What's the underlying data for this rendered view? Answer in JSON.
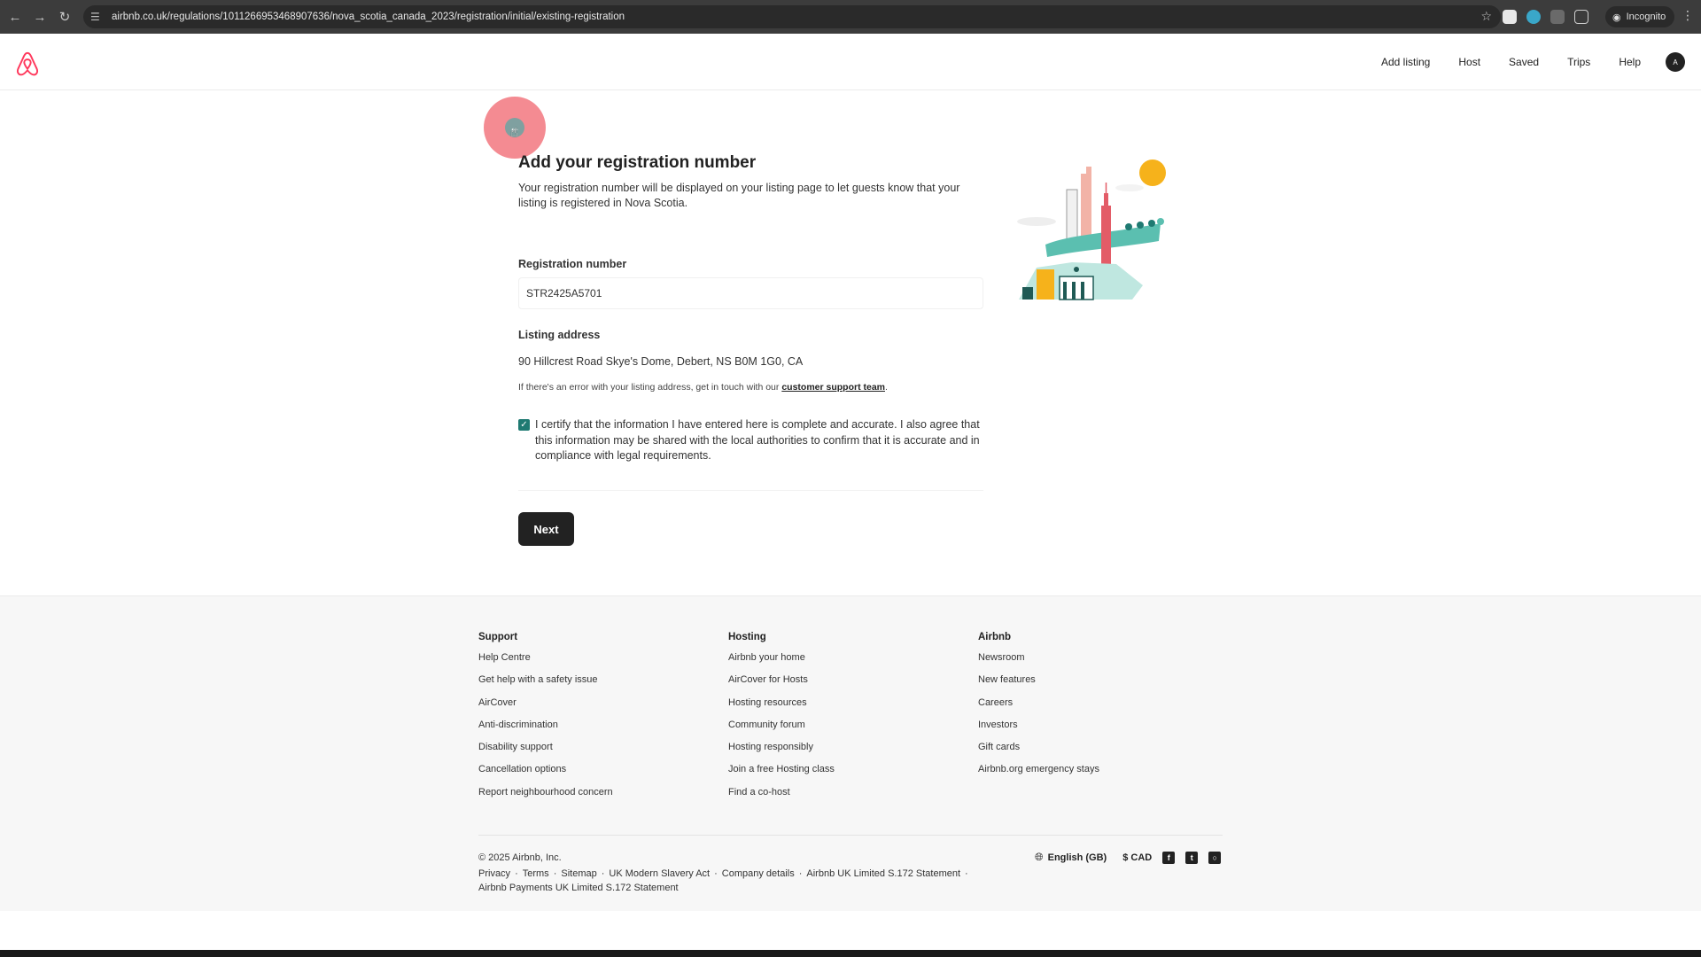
{
  "browser": {
    "url": "airbnb.co.uk/regulations/1011266953468907636/nova_scotia_canada_2023/registration/initial/existing-registration",
    "profile_label": "Incognito"
  },
  "header": {
    "nav": [
      "Add listing",
      "Host",
      "Saved",
      "Trips",
      "Help"
    ],
    "avatar_initial": "A"
  },
  "main": {
    "title": "Add your registration number",
    "description": "Your registration number will be displayed on your listing page to let guests know that your listing is registered in Nova Scotia.",
    "registration_label": "Registration number",
    "registration_value": "STR2425A5701",
    "address_label": "Listing address",
    "address_value": "90 Hillcrest Road Skye's Dome, Debert, NS B0M 1G0, CA",
    "support_note_prefix": "If there's an error with your listing address, get in touch with our ",
    "support_link": "customer support team",
    "support_note_suffix": ".",
    "certify_text": "I certify that the information I have entered here is complete and accurate. I also agree that this information may be shared with the local authorities to confirm that it is accurate and in compliance with legal requirements.",
    "certify_checked": true,
    "next_label": "Next"
  },
  "footer": {
    "columns": [
      {
        "title": "Support",
        "links": [
          "Help Centre",
          "Get help with a safety issue",
          "AirCover",
          "Anti-discrimination",
          "Disability support",
          "Cancellation options",
          "Report neighbourhood concern"
        ]
      },
      {
        "title": "Hosting",
        "links": [
          "Airbnb your home",
          "AirCover for Hosts",
          "Hosting resources",
          "Community forum",
          "Hosting responsibly",
          "Join a free Hosting class",
          "Find a co-host"
        ]
      },
      {
        "title": "Airbnb",
        "links": [
          "Newsroom",
          "New features",
          "Careers",
          "Investors",
          "Gift cards",
          "Airbnb.org emergency stays"
        ]
      }
    ],
    "copyright": "© 2025 Airbnb, Inc.",
    "legal": [
      "Privacy",
      "Terms",
      "Sitemap",
      "UK Modern Slavery Act",
      "Company details",
      "Airbnb UK Limited S.172 Statement",
      "Airbnb Payments UK Limited S.172 Statement"
    ],
    "language": "English (GB)",
    "currency": "$ CAD"
  },
  "colors": {
    "brand": "#ff385c",
    "checkbox": "#1f7a72",
    "button": "#222222"
  }
}
